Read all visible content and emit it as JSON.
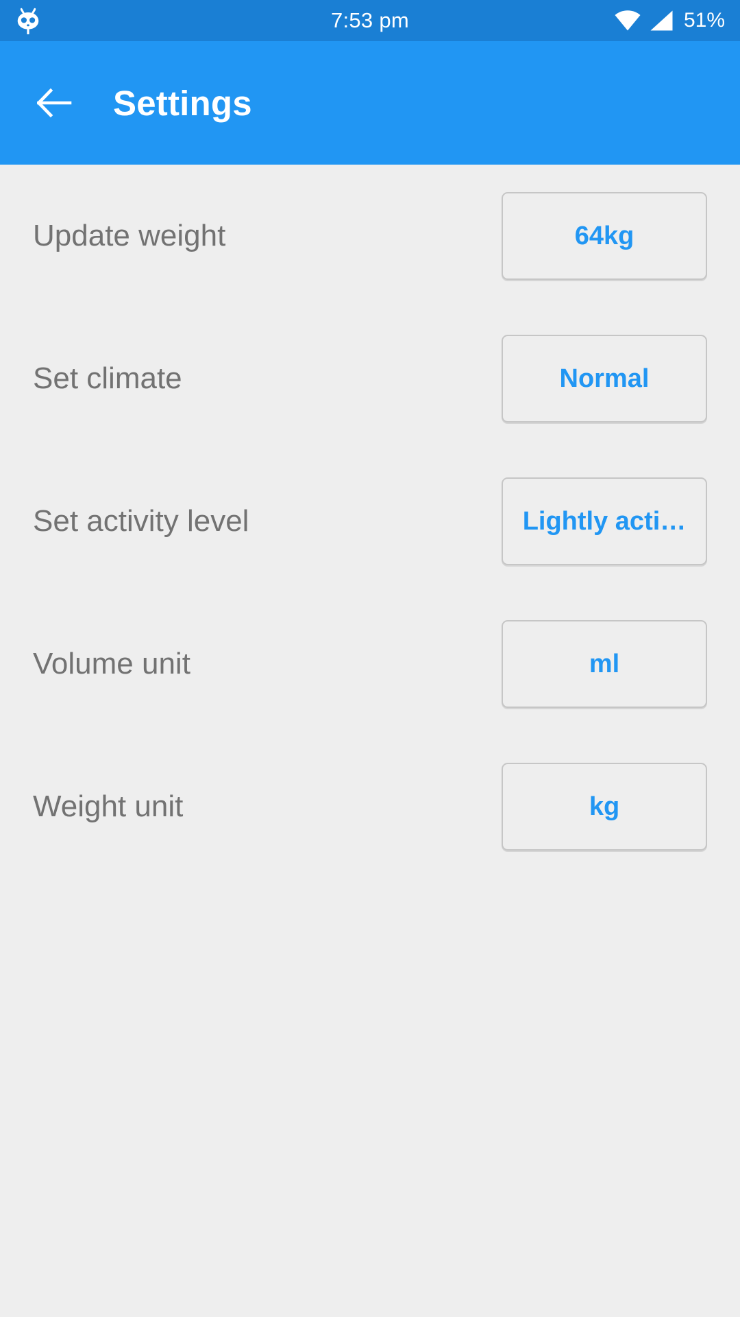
{
  "status_bar": {
    "logo_icon": "cyanogenmod-cid-icon",
    "time": "7:53 pm",
    "wifi_icon": "wifi-full-icon",
    "signal_icon": "cellular-signal-icon",
    "battery_percent": "51%"
  },
  "app_bar": {
    "back_icon": "back-arrow-icon",
    "title": "Settings",
    "background_color": "#2196f3"
  },
  "theme": {
    "accent_color": "#2196f3",
    "status_bar_color": "#1a7fd4",
    "page_background": "#eeeeee",
    "label_color": "#727272",
    "button_border_color": "#c6c6c6"
  },
  "settings": {
    "rows": [
      {
        "label": "Update weight",
        "value": "64kg"
      },
      {
        "label": "Set climate",
        "value": "Normal"
      },
      {
        "label": "Set activity level",
        "value": "Lightly acti…"
      },
      {
        "label": "Volume unit",
        "value": "ml"
      },
      {
        "label": "Weight unit",
        "value": "kg"
      }
    ]
  }
}
